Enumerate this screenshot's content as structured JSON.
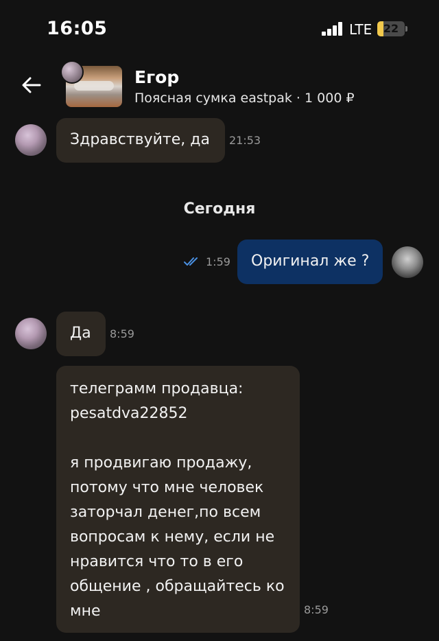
{
  "status_bar": {
    "time": "16:05",
    "network": "LTE",
    "battery": "22",
    "battery_level_percent": 22,
    "battery_color": "#f2c94c"
  },
  "header": {
    "name": "Егор",
    "subtitle": "Поясная сумка eastpak · 1 000 ₽"
  },
  "day_separator": "Сегодня",
  "messages": [
    {
      "direction": "incoming",
      "text": "Здравствуйте, да",
      "time": "21:53"
    },
    {
      "direction": "outgoing",
      "text": "Оригинал же ?",
      "time": "1:59",
      "read": true
    },
    {
      "direction": "incoming",
      "text": "Да",
      "time": "8:59"
    },
    {
      "direction": "incoming",
      "text": "телеграмм продавца:\npesatdva22852\n\nя продвигаю продажу,\nпотому что мне человек\nзаторчал денег,по всем\nвопросам к нему, если не\nнравится что то в его\nобщение , обращайтесь ко\nмне",
      "time": "8:59"
    }
  ],
  "colors": {
    "background": "#121212",
    "incoming_bubble": "#2d2822",
    "outgoing_bubble": "#0d3163",
    "read_ticks": "#4a90e2"
  }
}
